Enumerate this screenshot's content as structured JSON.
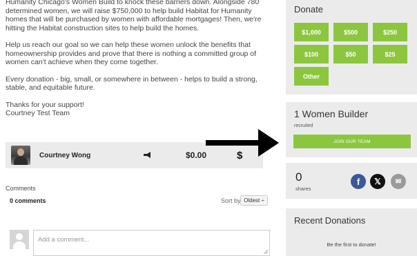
{
  "story": {
    "top_partial": "Humanity Chicago's Women Build to knock these barriers down. Alongside 780 determined women, we will raise $750,000 to help build Habitat for Humanity homes that will be purchased by women with affordable mortgages! Then, we're hitting the Habitat construction sites to help build the homes.",
    "p2": "Help us reach our goal so we can help these women unlock the benefits that homeownership provides and prove that there is nothing a committed group of women can't achieve when they come together.",
    "p3": "Every donation - big, small, or somewhere in between - helps to build a strong, stable, and equitable future.",
    "p4_line1": "Thanks for your support!",
    "p4_line2": "Courtney Test Team"
  },
  "member": {
    "name": "Courtney Wong",
    "amount": "$0.00",
    "currency_symbol": "$",
    "icon": "megaphone-icon"
  },
  "comments": {
    "label": "Comments",
    "count": "0 comments",
    "sort_label": "Sort by",
    "sort_value": "Oldest ÷",
    "placeholder": "Add a comment..."
  },
  "donate": {
    "title": "Donate",
    "amounts": [
      "$1,000",
      "$500",
      "$250",
      "$100",
      "$50",
      "$25",
      "Other"
    ]
  },
  "team": {
    "title": "1 Women Builder",
    "recruited": "recruited",
    "join_label": "JOIN OUR TEAM"
  },
  "shares": {
    "count": "0",
    "label": "shares"
  },
  "recent": {
    "title": "Recent Donations",
    "empty": "Be the first to donate!"
  },
  "colors": {
    "accent": "#8cc63f",
    "panel_bg": "#ebebeb",
    "facebook": "#3b5998"
  }
}
